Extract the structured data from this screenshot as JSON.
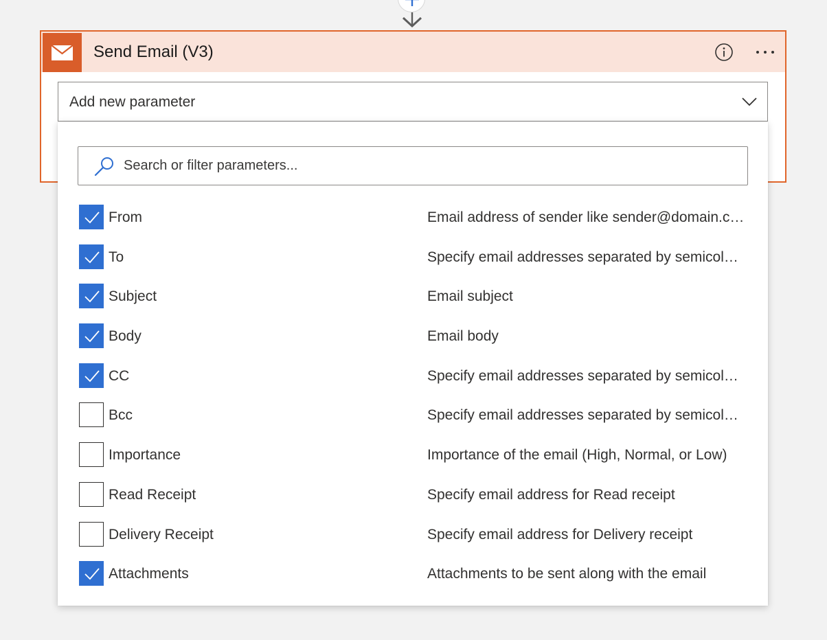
{
  "connector": {
    "add_icon": "plus-icon",
    "arrow_icon": "arrow-down-icon"
  },
  "card": {
    "title": "Send Email (V3)",
    "icon": "mail-icon",
    "info_icon": "info-icon",
    "more_icon": "more-icon",
    "accent_color": "#e0652a",
    "header_color": "#fae3da"
  },
  "dropdown": {
    "label": "Add new parameter",
    "chevron_icon": "chevron-down-icon"
  },
  "search": {
    "placeholder": "Search or filter parameters..."
  },
  "parameters": [
    {
      "name": "From",
      "description": "Email address of sender like sender@domain.com",
      "checked": true
    },
    {
      "name": "To",
      "description": "Specify email addresses separated by semicolons like someone@contoso.com",
      "checked": true
    },
    {
      "name": "Subject",
      "description": "Email subject",
      "checked": true
    },
    {
      "name": "Body",
      "description": "Email body",
      "checked": true
    },
    {
      "name": "CC",
      "description": "Specify email addresses separated by semicolons like someone@contoso.com",
      "checked": true
    },
    {
      "name": "Bcc",
      "description": "Specify email addresses separated by semicolons like someone@contoso.com",
      "checked": false
    },
    {
      "name": "Importance",
      "description": "Importance of the email (High, Normal, or Low)",
      "checked": false
    },
    {
      "name": "Read Receipt",
      "description": "Specify email address for Read receipt",
      "checked": false
    },
    {
      "name": "Delivery Receipt",
      "description": "Specify email address for Delivery receipt",
      "checked": false
    },
    {
      "name": "Attachments",
      "description": "Attachments to be sent along with the email",
      "checked": true
    }
  ],
  "colors": {
    "checkbox_checked": "#2f6fd1",
    "border": "#8a8886"
  }
}
